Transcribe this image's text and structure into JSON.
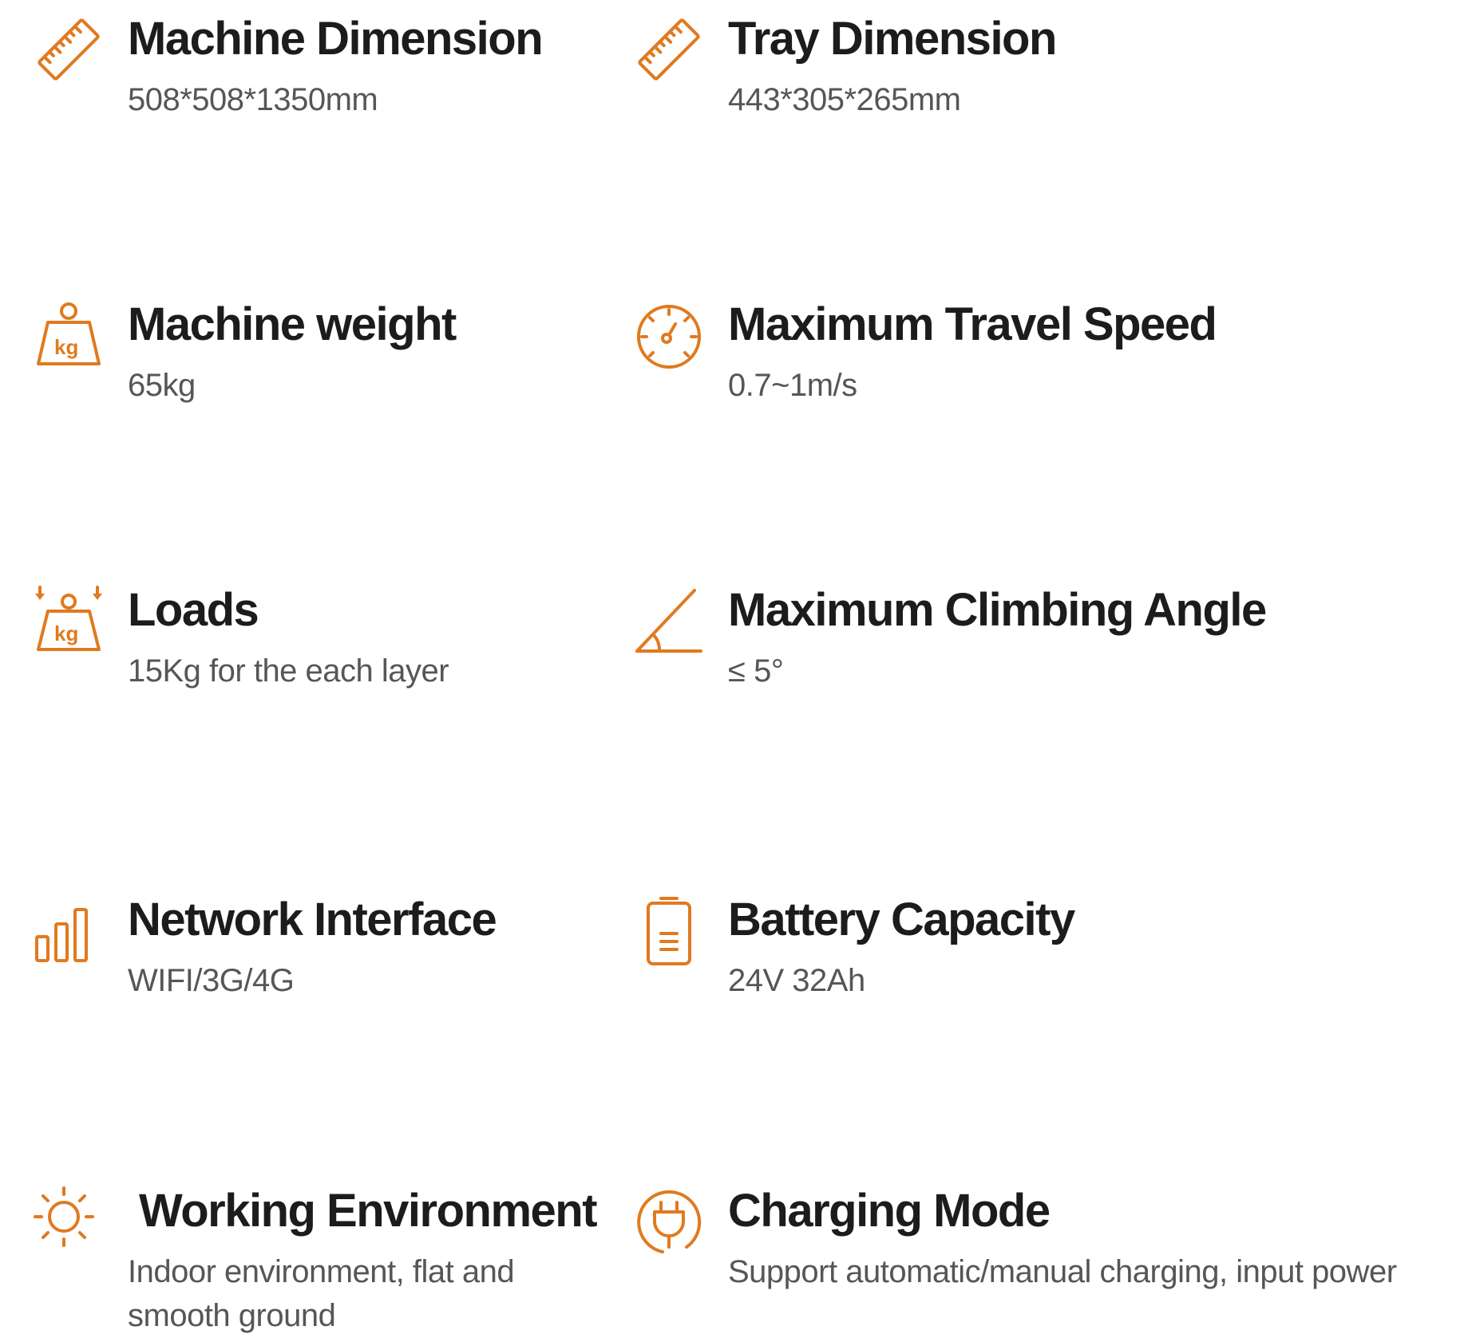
{
  "colors": {
    "accent": "#e07a1f",
    "title": "#1c1c1c",
    "value": "#565656",
    "background": "#ffffff"
  },
  "specs": [
    {
      "icon": "ruler-icon",
      "title": "Machine Dimension",
      "value": "508*508*1350mm"
    },
    {
      "icon": "ruler-icon",
      "title": "Tray Dimension",
      "value": "443*305*265mm"
    },
    {
      "icon": "weight-kg-icon",
      "title": "Machine weight",
      "value": "65kg"
    },
    {
      "icon": "speedometer-icon",
      "title": "Maximum Travel Speed",
      "value": "0.7~1m/s"
    },
    {
      "icon": "load-kg-icon",
      "title": "Loads",
      "value": "15Kg for the each layer"
    },
    {
      "icon": "angle-icon",
      "title": "Maximum Climbing Angle",
      "value": "≤ 5°"
    },
    {
      "icon": "signal-bars-icon",
      "title": "Network Interface",
      "value": "WIFI/3G/4G"
    },
    {
      "icon": "battery-icon",
      "title": "Battery Capacity",
      "value": "24V 32Ah"
    },
    {
      "icon": "sun-icon",
      "title": "Working Environment",
      "value": "Indoor environment, flat and smooth ground"
    },
    {
      "icon": "plug-icon",
      "title": "Charging Mode",
      "value": "Support automatic/manual charging, input power"
    }
  ],
  "icon_labels": {
    "kg": "kg"
  }
}
